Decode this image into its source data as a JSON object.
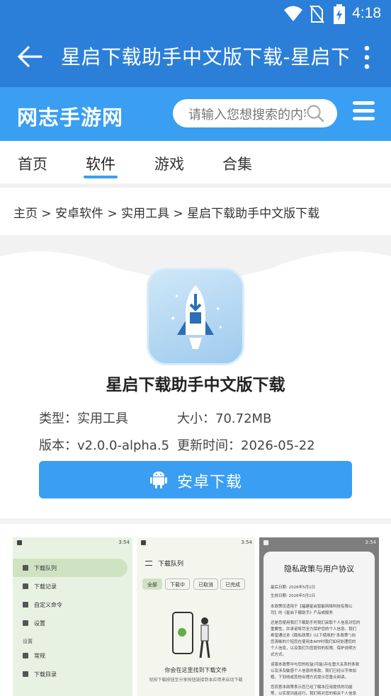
{
  "status_bar": {
    "time": "4:18",
    "icons": [
      "wifi-icon",
      "no-sim-icon",
      "battery-charging-icon"
    ]
  },
  "app_bar": {
    "title": "星启下载助手中文版下载-星启下载助手安",
    "back_icon": "arrow-left-icon",
    "more_icon": "more-vert-icon"
  },
  "site": {
    "logo": "网志手游网",
    "search_placeholder": "请输入您想搜索的内容",
    "menu_icon": "hamburger-menu-icon"
  },
  "tabs": [
    {
      "label": "首页",
      "active": false
    },
    {
      "label": "软件",
      "active": true
    },
    {
      "label": "游戏",
      "active": false
    },
    {
      "label": "合集",
      "active": false
    }
  ],
  "breadcrumb": "主页 > 安卓软件 > 实用工具 > 星启下载助手中文版下载",
  "app": {
    "icon": "rocket-download-icon",
    "name": "星启下载助手中文版下载",
    "type_label": "类型：实用工具",
    "size_label": "大小：70.72MB",
    "version_label": "版本：v2.0.0-alpha.5",
    "update_label": "更新时间：2026-05-22",
    "download_button": "安卓下载",
    "download_icon": "android-icon"
  },
  "screenshots": {
    "shot1": {
      "time": "3:54",
      "items": [
        "下载队列",
        "下载记录",
        "自定义命令",
        "设置"
      ],
      "section": "设置",
      "items2": [
        "常规",
        "下载目录"
      ]
    },
    "shot2": {
      "time": "3:54",
      "title": "下载队列",
      "chips": [
        "全部",
        "下载中",
        "已取消",
        "已完成"
      ],
      "caption": "你会在这里找到下载文件",
      "sub": "轻按下载按钮至分享按钮链接到本应用来启动下载"
    },
    "shot3": {
      "time": "3:54",
      "title": "隐私政策与用户协议",
      "lines": [
        "最后日期: 2026年5月1日",
        "生效日期: 2026年5月1日",
        "本政策仅适用于【福建星启智能网络科技有限公",
        "司】的《星启下载助手》产品或服务",
        "还是您使用我们下载助手时我们采取个人信息对您的",
        "重要性，并承诺将尽全力保护您的个人信息。我们",
        "希望通过本《隐私政策》(以下使用的“本政策”)向",
        "您清晰的介绍您在使用本APP时我们如何处理您的",
        "个人信息，以及我们为您提供的权限、保护说明方",
        "式方式。",
        "该版本政策中与您的权益(可能)存在重大关系的条款",
        "以及涉及敏感个人信息的条款，我们已经以字体加",
        "粗、下划线或其他合理方式提示您重点阅读。",
        "您同意本政策表示您已经了解本应用提供的功能",
        "等，以实现功能运行，我们将对您的相关个人信息"
      ]
    }
  },
  "colors": {
    "app_bar": "#2b7fd9",
    "site_header": "#3a9ef2",
    "accent": "#3a9ef2"
  }
}
